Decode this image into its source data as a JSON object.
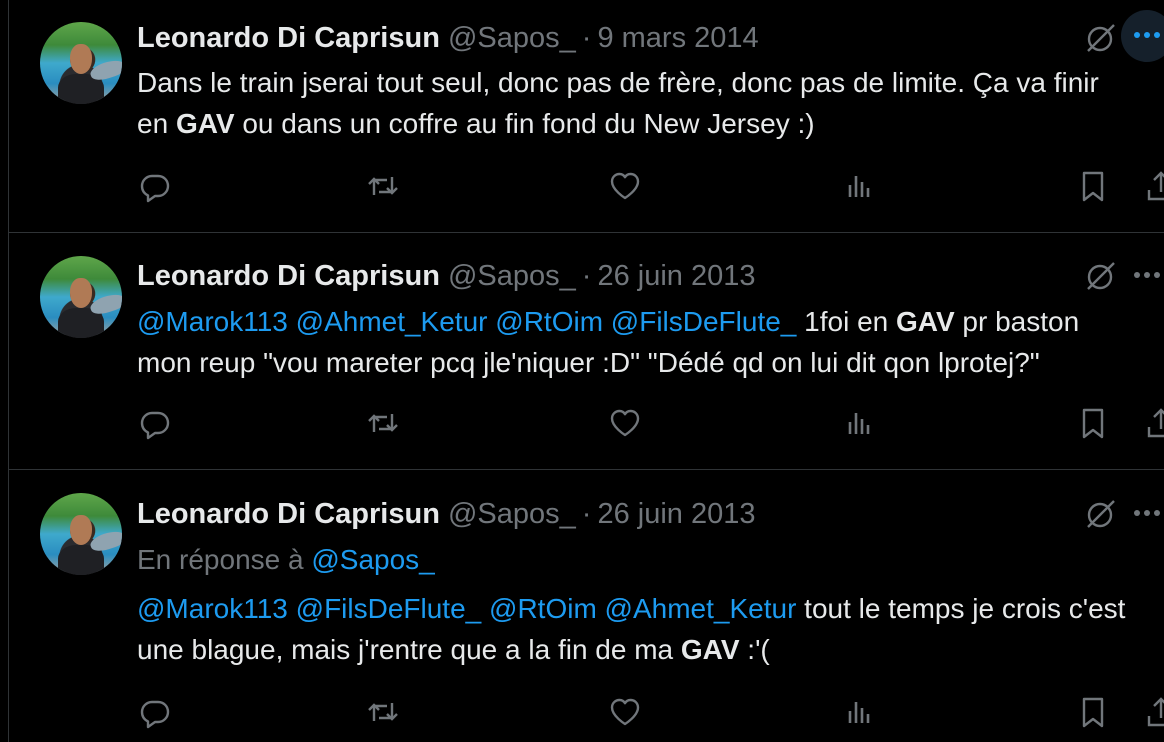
{
  "tweets": [
    {
      "name": "Leonardo Di Caprisun",
      "handle": "@Sapos_",
      "separator": "·",
      "date": "9 mars 2014",
      "reply_prefix": "",
      "reply_to": "",
      "mentions": [],
      "text_pre": "Dans le train jserai tout seul, donc pas de frère, donc pas de limite. Ça va finir en ",
      "highlight": "GAV",
      "text_post": " ou dans un coffre au fin fond du New Jersey :)"
    },
    {
      "name": "Leonardo Di Caprisun",
      "handle": "@Sapos_",
      "separator": "·",
      "date": "26 juin 2013",
      "reply_prefix": "",
      "reply_to": "",
      "mentions": [
        "@Marok113",
        "@Ahmet_Ketur",
        "@RtOim",
        "@FilsDeFlute_"
      ],
      "text_pre": " 1foi en ",
      "highlight": "GAV",
      "text_post": " pr baston mon reup \"vou mareter pcq jle'niquer :D\" \"Dédé qd on lui dit qon lprotej?\""
    },
    {
      "name": "Leonardo Di Caprisun",
      "handle": "@Sapos_",
      "separator": "·",
      "date": "26 juin 2013",
      "reply_prefix": "En réponse à ",
      "reply_to": "@Sapos_",
      "mentions": [
        "@Marok113",
        "@FilsDeFlute_",
        "@RtOim",
        "@Ahmet_Ketur"
      ],
      "text_pre": " tout le temps je crois c'est une blague, mais j'rentre que a la fin de ma ",
      "highlight": "GAV",
      "text_post": " :'("
    }
  ],
  "icons": {
    "reply": "reply-icon",
    "retweet": "retweet-icon",
    "like": "like-icon",
    "views": "views-icon",
    "bookmark": "bookmark-icon",
    "share": "share-icon",
    "grok": "grok-icon",
    "more": "more-icon"
  },
  "colors": {
    "background": "#000000",
    "text": "#e7e9ea",
    "muted": "#71767b",
    "accent": "#1d9bf0",
    "border": "#2f3336"
  }
}
